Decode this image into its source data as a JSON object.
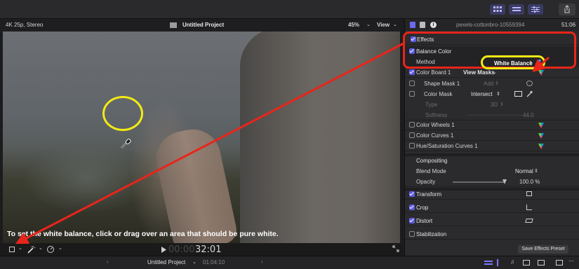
{
  "viewer": {
    "format": "4K 25p, Stereo",
    "project_title": "Untitled Project",
    "zoom": "45%",
    "view_menu": "View",
    "hint": "To set the white balance, click or drag over an area that should be pure white.",
    "timecode_dim": "00:00",
    "timecode": "32:01"
  },
  "inspector": {
    "clip_name": "pexels-cottonbro-10559394",
    "clip_duration": "51:06",
    "effects_label": "Effects",
    "balance_color": {
      "label": "Balance Color",
      "method_label": "Method",
      "method_value": "White Balance"
    },
    "color_board": {
      "label": "Color Board 1",
      "mask_menu": "View Masks"
    },
    "shape_mask": {
      "label": "Shape Mask 1",
      "add": "Add"
    },
    "color_mask": {
      "label": "Color Mask",
      "mode": "Intersect"
    },
    "type": {
      "label": "Type",
      "value": "3D"
    },
    "softness": {
      "label": "Softness",
      "value": "44.0"
    },
    "color_wheels": "Color Wheels 1",
    "color_curves": "Color Curves 1",
    "hue_sat": "Hue/Saturation Curves 1",
    "compositing": {
      "label": "Compositing",
      "blend_label": "Blend Mode",
      "blend_value": "Normal",
      "opacity_label": "Opacity",
      "opacity_value": "100.0 %"
    },
    "transform": "Transform",
    "crop": "Crop",
    "distort": "Distort",
    "stabilization": "Stabilization",
    "save_preset": "Save Effects Preset"
  },
  "timeline": {
    "project_title": "Untitled Project",
    "timecode": "01:04:10"
  },
  "colors": {
    "annotation_red": "#e8251a",
    "annotation_yellow": "#f4ea13",
    "accent": "#5e5ce6"
  }
}
